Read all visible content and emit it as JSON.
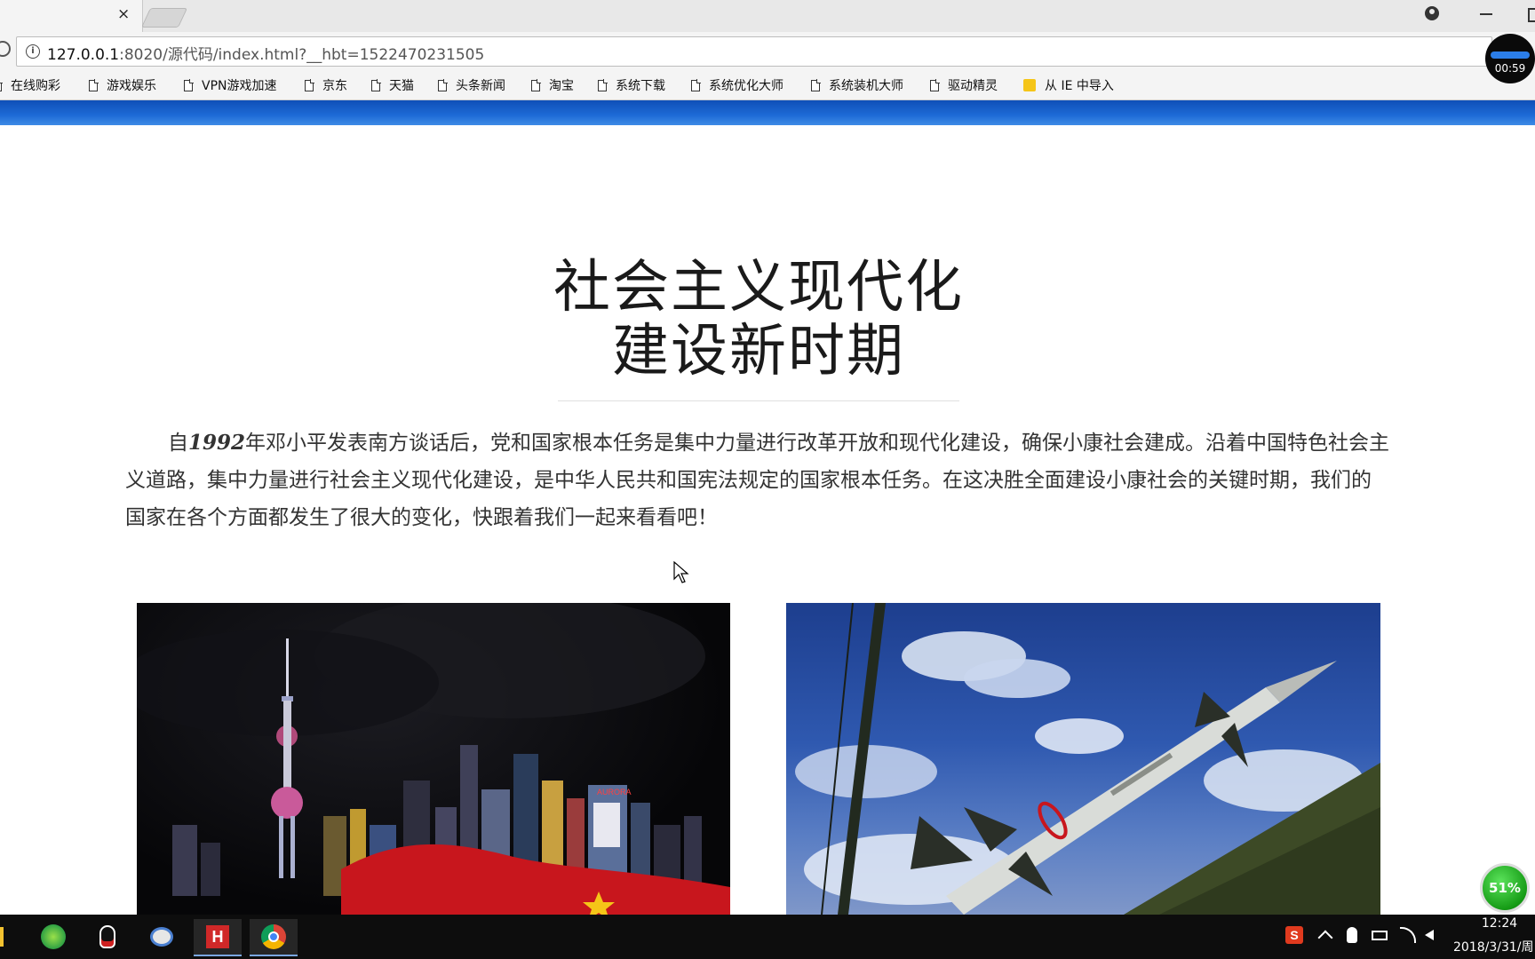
{
  "browser": {
    "tab_close": "×",
    "url_host": "127.0.0.1",
    "url_rest": ":8020/源代码/index.html?__hbt=1522470231505",
    "bookmarks": [
      {
        "label": "在线购彩"
      },
      {
        "label": "游戏娱乐"
      },
      {
        "label": "VPN游戏加速"
      },
      {
        "label": "京东"
      },
      {
        "label": "天猫"
      },
      {
        "label": "头条新闻"
      },
      {
        "label": "淘宝"
      },
      {
        "label": "系统下载"
      },
      {
        "label": "系统优化大师"
      },
      {
        "label": "系统装机大师"
      },
      {
        "label": "驱动精灵"
      },
      {
        "label": "从 IE 中导入"
      }
    ]
  },
  "page": {
    "title_line1": "社会主义现代化",
    "title_line2": "建设新时期",
    "intro_prefix": "自",
    "intro_year": "1992",
    "intro_body": "年邓小平发表南方谈话后，党和国家根本任务是集中力量进行改革开放和现代化建设，确保小康社会建成。沿着中国特色社会主义道路，集中力量进行社会主义现代化建设，是中华人民共和国宪法规定的国家根本任务。在这决胜全面建设小康社会的关键时期，我们的国家在各个方面都发生了很大的变化，快跟着我们一起来看看吧！",
    "photos": [
      {
        "subject": "shanghai-skyline-night",
        "sign_text": "AURORA"
      },
      {
        "subject": "missile-launcher"
      }
    ]
  },
  "overlay": {
    "timer": "00:59",
    "speed": "51%"
  },
  "taskbar": {
    "time": "12:24",
    "date": "2018/3/31/周"
  },
  "colors": {
    "banner": "#1d6ad6",
    "taskbar": "#0d0d0d",
    "speed_ball": "#169c16"
  }
}
